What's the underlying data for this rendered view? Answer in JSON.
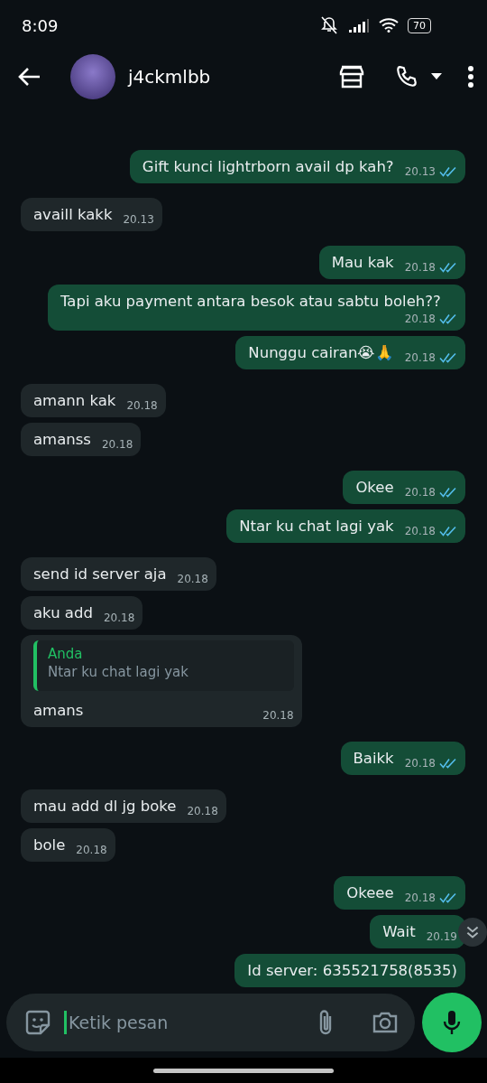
{
  "status_bar": {
    "time": "8:09",
    "battery": "70"
  },
  "header": {
    "contact": "j4ckmlbb"
  },
  "messages": [
    {
      "sent": true,
      "text": "Gift kunci lightrborn avail dp kah?",
      "time": "20.13",
      "read": true
    },
    {
      "sent": false,
      "text": "availl kakk",
      "time": "20.13"
    },
    {
      "sent": true,
      "text": "Mau kak",
      "time": "20.18",
      "read": true
    },
    {
      "sent": true,
      "text": "Tapi aku payment antara besok atau sabtu boleh??",
      "time": "20.18",
      "read": true
    },
    {
      "sent": true,
      "text": "Nunggu cairan😭🙏",
      "time": "20.18",
      "read": true
    },
    {
      "sent": false,
      "text": "amann kak",
      "time": "20.18"
    },
    {
      "sent": false,
      "text": "amanss",
      "time": "20.18"
    },
    {
      "sent": true,
      "text": "Okee",
      "time": "20.18",
      "read": true
    },
    {
      "sent": true,
      "text": "Ntar ku chat lagi yak",
      "time": "20.18",
      "read": true
    },
    {
      "sent": false,
      "text": "send id server aja",
      "time": "20.18"
    },
    {
      "sent": false,
      "text": "aku add",
      "time": "20.18"
    },
    {
      "sent": false,
      "text": "amans",
      "time": "20.18",
      "quote": {
        "author": "Anda",
        "text": "Ntar ku chat lagi yak"
      }
    },
    {
      "sent": true,
      "text": "Baikk",
      "time": "20.18",
      "read": true
    },
    {
      "sent": false,
      "text": "mau add dl jg boke",
      "time": "20.18"
    },
    {
      "sent": false,
      "text": "bole",
      "time": "20.18"
    },
    {
      "sent": true,
      "text": "Okeee",
      "time": "20.18",
      "read": true
    },
    {
      "sent": true,
      "text": "Wait",
      "time": "20.19"
    },
    {
      "sent": true,
      "text": "Id server: 635521758(8535)"
    }
  ],
  "composer": {
    "placeholder": "Ketik pesan"
  }
}
